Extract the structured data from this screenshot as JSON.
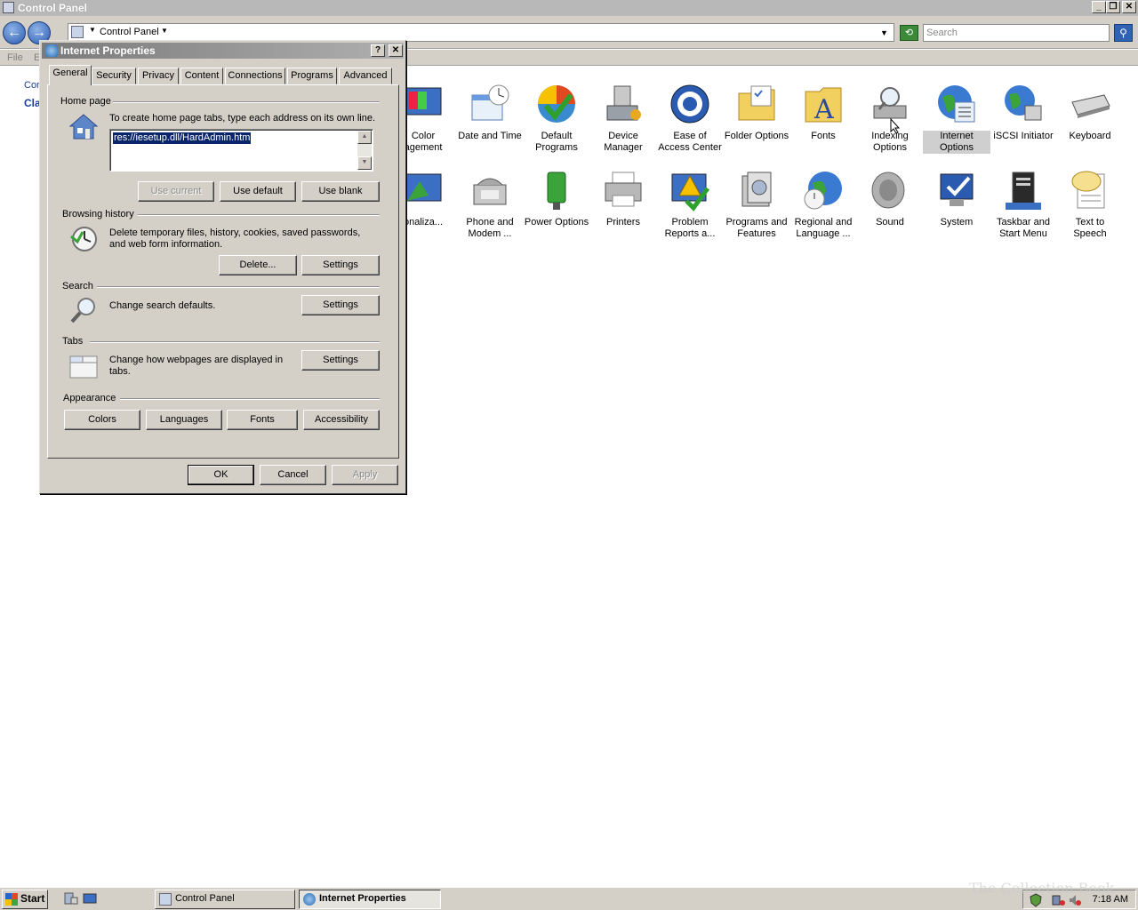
{
  "control_panel": {
    "title": "Control Panel",
    "address": "Control Panel",
    "search_placeholder": "Search",
    "menu": [
      "File",
      "E"
    ],
    "left_links": [
      "Cor",
      "Cla"
    ],
    "items_row1": [
      {
        "label": "Color\nagement",
        "icon": "color-management-icon"
      },
      {
        "label": "Date and Time",
        "icon": "date-time-icon"
      },
      {
        "label": "Default\nPrograms",
        "icon": "default-programs-icon"
      },
      {
        "label": "Device\nManager",
        "icon": "device-manager-icon"
      },
      {
        "label": "Ease of\nAccess Center",
        "icon": "ease-of-access-icon"
      },
      {
        "label": "Folder Options",
        "icon": "folder-options-icon"
      },
      {
        "label": "Fonts",
        "icon": "fonts-icon"
      },
      {
        "label": "Indexing\nOptions",
        "icon": "indexing-options-icon"
      },
      {
        "label": "Internet\nOptions",
        "icon": "internet-options-icon",
        "selected": true
      },
      {
        "label": "iSCSI Initiator",
        "icon": "iscsi-initiator-icon"
      },
      {
        "label": "Keyboard",
        "icon": "keyboard-icon"
      }
    ],
    "items_row2": [
      {
        "label": "onaliza...",
        "icon": "personalization-icon"
      },
      {
        "label": "Phone and\nModem ...",
        "icon": "phone-modem-icon"
      },
      {
        "label": "Power Options",
        "icon": "power-options-icon"
      },
      {
        "label": "Printers",
        "icon": "printers-icon"
      },
      {
        "label": "Problem\nReports a...",
        "icon": "problem-reports-icon"
      },
      {
        "label": "Programs and\nFeatures",
        "icon": "programs-features-icon"
      },
      {
        "label": "Regional and\nLanguage ...",
        "icon": "regional-language-icon"
      },
      {
        "label": "Sound",
        "icon": "sound-icon"
      },
      {
        "label": "System",
        "icon": "system-icon"
      },
      {
        "label": "Taskbar and\nStart Menu",
        "icon": "taskbar-start-menu-icon"
      },
      {
        "label": "Text to\nSpeech",
        "icon": "text-to-speech-icon"
      }
    ]
  },
  "dialog": {
    "title": "Internet Properties",
    "help_label": "?",
    "close_label": "✕",
    "tabs": [
      "General",
      "Security",
      "Privacy",
      "Content",
      "Connections",
      "Programs",
      "Advanced"
    ],
    "active_tab": "General",
    "home_page": {
      "group": "Home page",
      "description": "To create home page tabs, type each address on its own line.",
      "value": "res://iesetup.dll/HardAdmin.htm",
      "use_current": "Use current",
      "use_default": "Use default",
      "use_blank": "Use blank"
    },
    "browsing_history": {
      "group": "Browsing history",
      "description": "Delete temporary files, history, cookies, saved passwords, and web form information.",
      "delete": "Delete...",
      "settings": "Settings"
    },
    "search": {
      "group": "Search",
      "description": "Change search defaults.",
      "settings": "Settings"
    },
    "tabs_section": {
      "group": "Tabs",
      "description": "Change how webpages are displayed in tabs.",
      "settings": "Settings"
    },
    "appearance": {
      "group": "Appearance",
      "colors": "Colors",
      "languages": "Languages",
      "fonts": "Fonts",
      "accessibility": "Accessibility"
    },
    "ok": "OK",
    "cancel": "Cancel",
    "apply": "Apply"
  },
  "taskbar": {
    "start": "Start",
    "buttons": [
      "Control Panel",
      "Internet Properties"
    ],
    "clock": "7:18 AM",
    "watermark": "The Collection Book"
  }
}
